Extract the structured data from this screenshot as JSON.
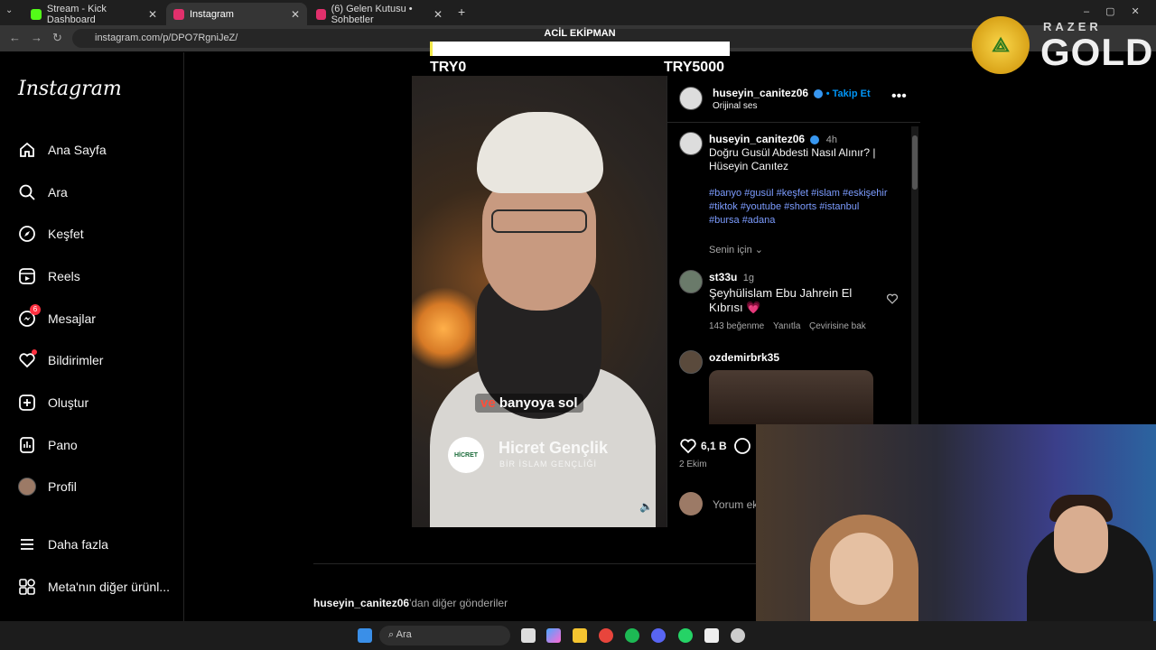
{
  "browser": {
    "tabs": [
      {
        "label": "Stream - Kick Dashboard",
        "color": "#53fc18"
      },
      {
        "label": "Instagram",
        "color": "#e1306c"
      },
      {
        "label": "(6) Gelen Kutusu • Sohbetler",
        "color": "#e1306c"
      }
    ],
    "url": "instagram.com/p/DPO7RgniJeZ/"
  },
  "sidebar": {
    "logo": "Instagram",
    "items": [
      {
        "label": "Ana Sayfa",
        "icon": "home-icon"
      },
      {
        "label": "Ara",
        "icon": "search-icon"
      },
      {
        "label": "Keşfet",
        "icon": "compass-icon"
      },
      {
        "label": "Reels",
        "icon": "reels-icon"
      },
      {
        "label": "Mesajlar",
        "icon": "messenger-icon",
        "badge": "6"
      },
      {
        "label": "Bildirimler",
        "icon": "heart-icon"
      },
      {
        "label": "Oluştur",
        "icon": "plus-icon"
      },
      {
        "label": "Pano",
        "icon": "dashboard-icon"
      },
      {
        "label": "Profil",
        "icon": "avatar-icon"
      },
      {
        "label": "Daha fazla",
        "icon": "menu-icon"
      },
      {
        "label": "Meta'nın diğer ürünl...",
        "icon": "apps-icon"
      }
    ]
  },
  "goal": {
    "title": "ACİL EKİPMAN",
    "min_label": "TRY0",
    "max_label": "TRY5000",
    "progress": 0.01
  },
  "post": {
    "author": "huseyin_canitez06",
    "follow": "• Takip Et",
    "audio": "Orijinal ses",
    "time": "4h",
    "caption_line1": "Doğru Gusül Abdesti Nasıl Alınır? |",
    "caption_line2": "Hüseyin Canıtez",
    "tags_line1": "#banyo #gusül #keşfet #islam #eskişehir",
    "tags_line2": "#tiktok #youtube #shorts #istanbul",
    "tags_line3": "#bursa #adana",
    "for_you": "Senin için",
    "video_caption_hl": "ve",
    "video_caption": " banyoya sol",
    "brand_name": "Hicret Gençlik",
    "brand_sub": "BİR İSLAM GENÇLİĞİ",
    "brand_logo": "HİCRET",
    "likes": "6,1 B",
    "date": "2 Ekim",
    "comment_placeholder": "Yorum ek"
  },
  "comments": [
    {
      "user": "st33u",
      "time": "1g",
      "text1": "Şeyhülislam Ebu Jahrein El",
      "text2": "Kıbrısı 💗",
      "likes": "143 beğenme",
      "reply": "Yanıtla",
      "translate": "Çevirisine bak"
    },
    {
      "user": "ozdemirbrk35"
    }
  ],
  "footer": {
    "user": "huseyin_canitez06",
    "suffix": "'dan diğer gönderiler"
  },
  "razer": {
    "top": "RAZER",
    "gold": "GOLD"
  },
  "taskbar": {
    "search": "Ara"
  }
}
